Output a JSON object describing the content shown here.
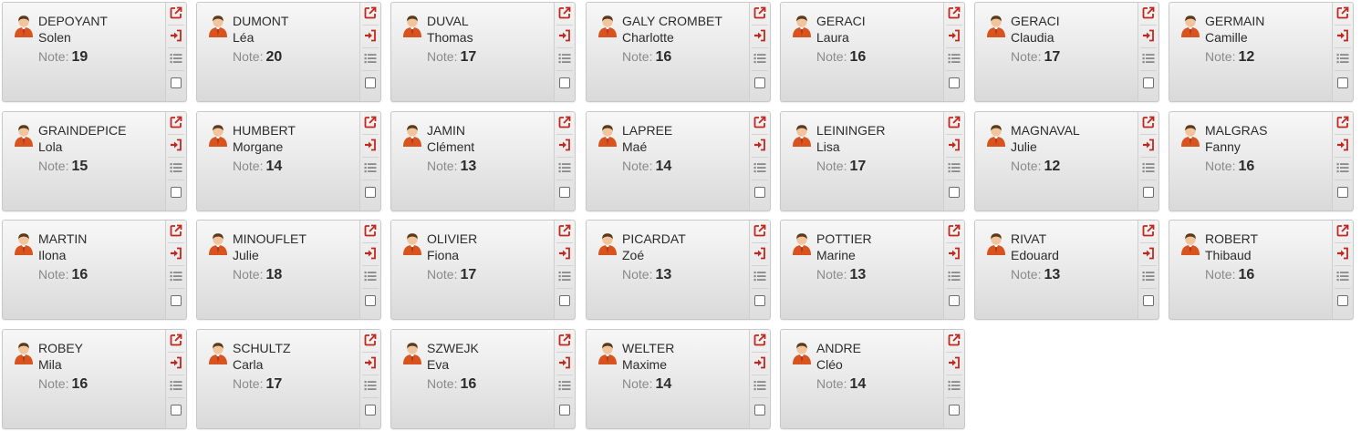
{
  "note_label": "Note:",
  "colors": {
    "icon_red": "#c0281f",
    "icon_gray": "#8a8a8a",
    "avatar_shirt": "#d9531e",
    "avatar_skin": "#f2c49b",
    "avatar_hair": "#5a3a1c"
  },
  "icons": {
    "avatar": "student-avatar-icon",
    "open": "external-link-icon",
    "enter": "sign-in-icon",
    "list": "list-icon",
    "select": "checkbox"
  },
  "students": [
    {
      "last": "DEPOYANT",
      "first": "Solen",
      "note": "19"
    },
    {
      "last": "DUMONT",
      "first": "Léa",
      "note": "20"
    },
    {
      "last": "DUVAL",
      "first": "Thomas",
      "note": "17"
    },
    {
      "last": "GALY CROMBET",
      "first": "Charlotte",
      "note": "16"
    },
    {
      "last": "GERACI",
      "first": "Laura",
      "note": "16"
    },
    {
      "last": "GERACI",
      "first": "Claudia",
      "note": "17"
    },
    {
      "last": "GERMAIN",
      "first": "Camille",
      "note": "12"
    },
    {
      "last": "GRAINDEPICE",
      "first": "Lola",
      "note": "15"
    },
    {
      "last": "HUMBERT",
      "first": "Morgane",
      "note": "14"
    },
    {
      "last": "JAMIN",
      "first": "Clément",
      "note": "13"
    },
    {
      "last": "LAPREE",
      "first": "Maé",
      "note": "14"
    },
    {
      "last": "LEININGER",
      "first": "Lisa",
      "note": "17"
    },
    {
      "last": "MAGNAVAL",
      "first": "Julie",
      "note": "12"
    },
    {
      "last": "MALGRAS",
      "first": "Fanny",
      "note": "16"
    },
    {
      "last": "MARTIN",
      "first": "Ilona",
      "note": "16"
    },
    {
      "last": "MINOUFLET",
      "first": "Julie",
      "note": "18"
    },
    {
      "last": "OLIVIER",
      "first": "Fiona",
      "note": "17"
    },
    {
      "last": "PICARDAT",
      "first": "Zoé",
      "note": "13"
    },
    {
      "last": "POTTIER",
      "first": "Marine",
      "note": "13"
    },
    {
      "last": "RIVAT",
      "first": "Edouard",
      "note": "13"
    },
    {
      "last": "ROBERT",
      "first": "Thibaud",
      "note": "16"
    },
    {
      "last": "ROBEY",
      "first": "Mila",
      "note": "16"
    },
    {
      "last": "SCHULTZ",
      "first": "Carla",
      "note": "17"
    },
    {
      "last": "SZWEJK",
      "first": "Eva",
      "note": "16"
    },
    {
      "last": "WELTER",
      "first": "Maxime",
      "note": "14"
    },
    {
      "last": "ANDRE",
      "first": "Cléo",
      "note": "14"
    }
  ]
}
